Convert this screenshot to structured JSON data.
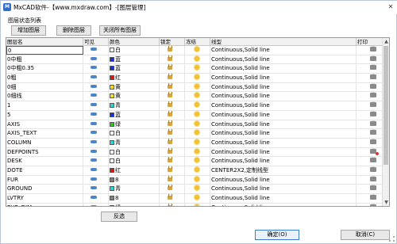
{
  "window": {
    "title": "MxCAD软件-【www.mxdraw.com】-[图层管理]",
    "app_icon_text": "M"
  },
  "group_label": "图层状态列表",
  "toolbar": {
    "add_label": "增加图层",
    "delete_label": "删除图层",
    "close_all_label": "关闭所有图层"
  },
  "table": {
    "columns": [
      "图层名",
      "可见",
      "颜色",
      "锁定",
      "冻结",
      "线型",
      "打印"
    ],
    "rows": [
      {
        "name": "0",
        "color_name": "白",
        "color": "#ffffff",
        "linetype": "Continuous,Solid line",
        "selected": true,
        "print_off": false
      },
      {
        "name": "0中粗",
        "color_name": "蓝",
        "color": "#1a2fd6",
        "linetype": "Continuous,Solid line",
        "print_off": false
      },
      {
        "name": "0中粗0.35",
        "color_name": "蓝",
        "color": "#1a2fd6",
        "linetype": "Continuous,Solid line",
        "print_off": false
      },
      {
        "name": "0粗",
        "color_name": "红",
        "color": "#d61a1a",
        "linetype": "Continuous,Solid line",
        "print_off": false
      },
      {
        "name": "0细",
        "color_name": "黄",
        "color": "#f1e11a",
        "linetype": "Continuous,Solid line",
        "print_off": false
      },
      {
        "name": "0细线",
        "color_name": "黄",
        "color": "#f1e11a",
        "linetype": "Continuous,Solid line",
        "print_off": false
      },
      {
        "name": "1",
        "color_name": "青",
        "color": "#27d6d6",
        "linetype": "Continuous,Solid line",
        "print_off": false
      },
      {
        "name": "5",
        "color_name": "蓝",
        "color": "#1a2fd6",
        "linetype": "Continuous,Solid line",
        "print_off": false
      },
      {
        "name": "AXIS",
        "color_name": "绿",
        "color": "#2fc42f",
        "linetype": "Continuous,Solid line",
        "print_off": false
      },
      {
        "name": "AXIS_TEXT",
        "color_name": "白",
        "color": "#ffffff",
        "linetype": "Continuous,Solid line",
        "print_off": false
      },
      {
        "name": "COLUMN",
        "color_name": "青",
        "color": "#27d6d6",
        "linetype": "Continuous,Solid line",
        "print_off": false
      },
      {
        "name": "DEFPOINTS",
        "color_name": "白",
        "color": "#ffffff",
        "linetype": "Continuous,Solid line",
        "print_off": true
      },
      {
        "name": "DESK",
        "color_name": "白",
        "color": "#ffffff",
        "linetype": "Continuous,Solid line",
        "print_off": false
      },
      {
        "name": "DOTE",
        "color_name": "红",
        "color": "#d61a1a",
        "linetype": "CENTER2X2,定制线型",
        "print_off": false
      },
      {
        "name": "FUR",
        "color_name": "8",
        "color": "#808080",
        "linetype": "Continuous,Solid line",
        "print_off": false
      },
      {
        "name": "GROUND",
        "color_name": "青",
        "color": "#27d6d6",
        "linetype": "Continuous,Solid line",
        "print_off": false
      },
      {
        "name": "LVTRY",
        "color_name": "8",
        "color": "#808080",
        "linetype": "Continuous,Solid line",
        "print_off": false
      },
      {
        "name": "PUB_DIM",
        "color_name": "绿",
        "color": "#2fc42f",
        "linetype": "Continuous,Solid line",
        "print_off": false
      }
    ]
  },
  "buttons": {
    "invert_label": "反选",
    "ok_label": "确定(O)",
    "cancel_label": "取消(C)"
  },
  "icons": {
    "visible": "eye-icon",
    "lock": "lock-icon",
    "freeze": "sun-icon",
    "print": "printer-icon"
  }
}
